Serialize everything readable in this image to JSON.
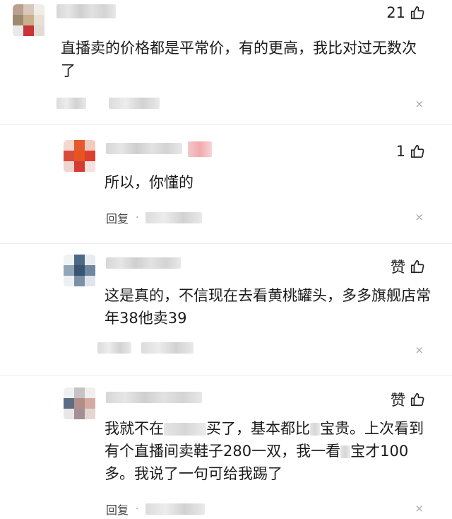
{
  "comments": [
    {
      "likes": "21",
      "text": "直播卖的价格都是平常价，有的更高，我比对过无数次了",
      "close": "×"
    },
    {
      "likes": "1",
      "text": "所以，你懂的",
      "reply": "回复",
      "close": "×"
    },
    {
      "likes": "赞",
      "text": "这是真的，不信现在去看黄桃罐头，多多旗舰店常年38他卖39",
      "close": "×"
    },
    {
      "likes": "赞",
      "text_parts": [
        "我就不在",
        "买了，基本都比",
        "宝贵。上次看到有个直播间卖鞋子280一双，我一看",
        "宝才100多。我说了一句可给我踢了"
      ],
      "reply": "回复",
      "close": "×"
    }
  ],
  "icons": {
    "like": "thumbs-up-icon",
    "close": "close-icon"
  },
  "colors": {
    "text": "#1a1a1a",
    "meta": "#444444",
    "separator": "#ececec"
  }
}
